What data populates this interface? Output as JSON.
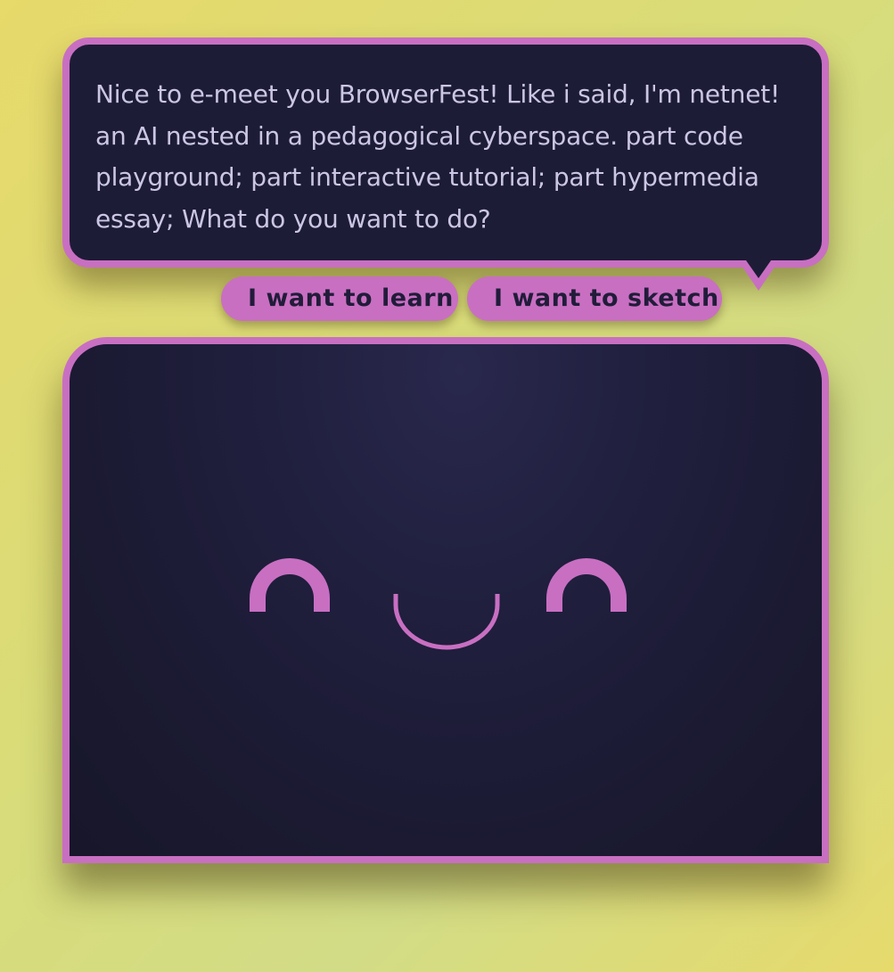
{
  "speech_bubble": {
    "message": "Nice to e-meet you BrowserFest! Like i said, I'm netnet! an AI nested in a pedagogical cyberspace. part code playground; part interactive tutorial; part hypermedia essay; What do you want to do?"
  },
  "options": [
    {
      "label": "I want to learn"
    },
    {
      "label": "I want to sketch"
    }
  ],
  "face": {
    "expression": "happy",
    "left_eye_icon": "arch-eye",
    "mouth_icon": "smile-mouth",
    "right_eye_icon": "arch-eye"
  },
  "colors": {
    "background": "#e2da6e",
    "accent": "#c86fc2",
    "panel": "#1d1c36",
    "text": "#cbc6e4",
    "button_text": "#211c3a"
  }
}
